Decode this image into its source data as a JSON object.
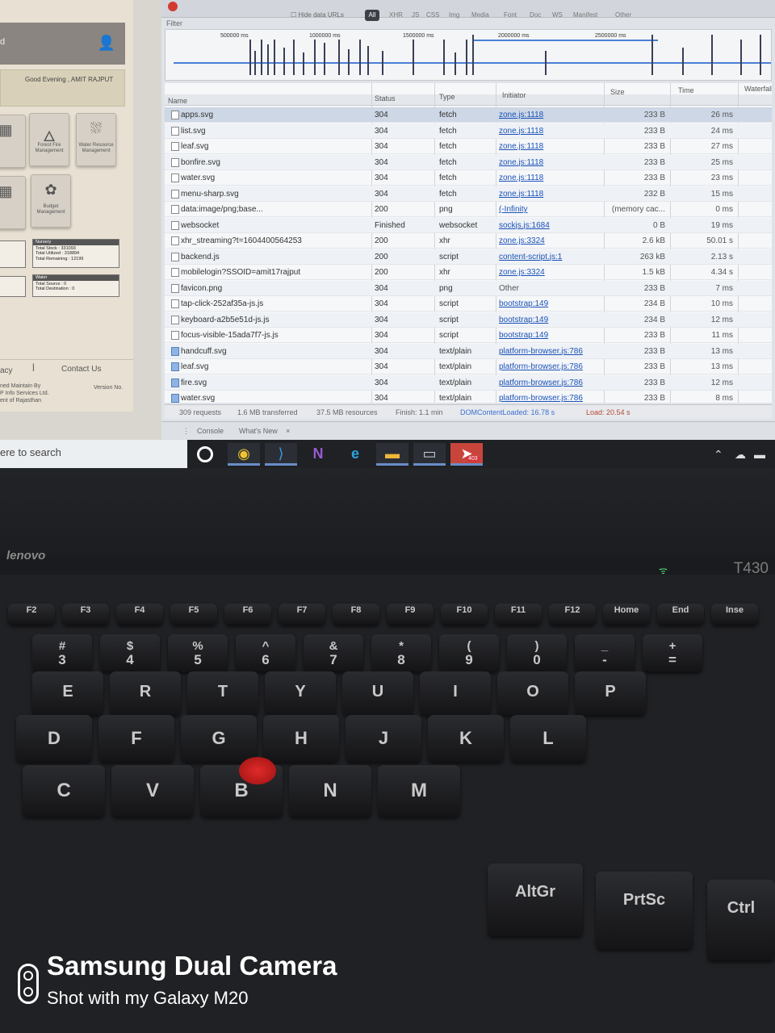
{
  "app": {
    "greeting": "Good Evening , AMIT RAJPUT",
    "tiles": [
      {
        "label": "Forest Fire Management",
        "icon": "fire-icon"
      },
      {
        "label": "Water Resource Management",
        "icon": "water-icon"
      },
      {
        "label": "Budget Management",
        "icon": "budget-icon"
      }
    ],
    "nursery": {
      "title": "Nursery",
      "lines": [
        "Total Stock : 331093",
        "Total Utilized : 318894",
        "Total Remaining : 12199"
      ]
    },
    "water": {
      "title": "Water",
      "lines": [
        "Total Source : 0",
        "Total Destination : 0"
      ]
    },
    "footer": {
      "policy": "acy",
      "contact": "Contact Us",
      "maintain": [
        "ned Maintain By",
        "P Info Services Ltd.",
        "ent of Rajasthan"
      ],
      "version": "Version No."
    }
  },
  "devtools": {
    "filter_placeholder": "Filter",
    "hide_data_urls": "Hide data URLs",
    "filter_tabs": [
      "All",
      "XHR",
      "JS",
      "CSS",
      "Img",
      "Media",
      "Font",
      "Doc",
      "WS",
      "Manifest",
      "Other"
    ],
    "timeline_ticks": [
      "500000 ms",
      "1000000 ms",
      "1500000 ms",
      "2000000 ms",
      "2500000 ms"
    ],
    "columns": {
      "name": "Name",
      "status": "Status",
      "type": "Type",
      "initiator": "Initiator",
      "size": "Size",
      "time": "Time",
      "waterfall": "Waterfall"
    },
    "rows": [
      {
        "name": "apps.svg",
        "status": "304",
        "type": "fetch",
        "initiator": "zone.js:1118",
        "size": "233 B",
        "time": "26 ms",
        "kind": "doc"
      },
      {
        "name": "list.svg",
        "status": "304",
        "type": "fetch",
        "initiator": "zone.js:1118",
        "size": "233 B",
        "time": "24 ms",
        "kind": "doc"
      },
      {
        "name": "leaf.svg",
        "status": "304",
        "type": "fetch",
        "initiator": "zone.js:1118",
        "size": "233 B",
        "time": "27 ms",
        "kind": "doc"
      },
      {
        "name": "bonfire.svg",
        "status": "304",
        "type": "fetch",
        "initiator": "zone.js:1118",
        "size": "233 B",
        "time": "25 ms",
        "kind": "doc"
      },
      {
        "name": "water.svg",
        "status": "304",
        "type": "fetch",
        "initiator": "zone.js:1118",
        "size": "233 B",
        "time": "23 ms",
        "kind": "doc"
      },
      {
        "name": "menu-sharp.svg",
        "status": "304",
        "type": "fetch",
        "initiator": "zone.js:1118",
        "size": "232 B",
        "time": "15 ms",
        "kind": "doc"
      },
      {
        "name": "data:image/png;base...",
        "status": "200",
        "type": "png",
        "initiator": "(-Infinity",
        "size": "(memory cac...",
        "time": "0 ms",
        "kind": "doc"
      },
      {
        "name": "websocket",
        "status": "Finished",
        "type": "websocket",
        "initiator": "sockjs.js:1684",
        "size": "0 B",
        "time": "19 ms",
        "kind": "doc"
      },
      {
        "name": "xhr_streaming?t=1604400564253",
        "status": "200",
        "type": "xhr",
        "initiator": "zone.js:3324",
        "size": "2.6 kB",
        "time": "50.01 s",
        "kind": "doc"
      },
      {
        "name": "backend.js",
        "status": "200",
        "type": "script",
        "initiator": "content-script.js:1",
        "size": "263 kB",
        "time": "2.13 s",
        "kind": "doc"
      },
      {
        "name": "mobilelogin?SSOID=amit17rajput",
        "status": "200",
        "type": "xhr",
        "initiator": "zone.js:3324",
        "size": "1.5 kB",
        "time": "4.34 s",
        "kind": "doc"
      },
      {
        "name": "favicon.png",
        "status": "304",
        "type": "png",
        "initiator": "Other",
        "size": "233 B",
        "time": "7 ms",
        "kind": "doc"
      },
      {
        "name": "tap-click-252af35a-js.js",
        "status": "304",
        "type": "script",
        "initiator": "bootstrap:149",
        "size": "234 B",
        "time": "10 ms",
        "kind": "doc"
      },
      {
        "name": "keyboard-a2b5e51d-js.js",
        "status": "304",
        "type": "script",
        "initiator": "bootstrap:149",
        "size": "234 B",
        "time": "12 ms",
        "kind": "doc"
      },
      {
        "name": "focus-visible-15ada7f7-js.js",
        "status": "304",
        "type": "script",
        "initiator": "bootstrap:149",
        "size": "233 B",
        "time": "11 ms",
        "kind": "doc"
      },
      {
        "name": "handcuff.svg",
        "status": "304",
        "type": "text/plain",
        "initiator": "platform-browser.js:786",
        "size": "233 B",
        "time": "13 ms",
        "kind": "img"
      },
      {
        "name": "leaf.svg",
        "status": "304",
        "type": "text/plain",
        "initiator": "platform-browser.js:786",
        "size": "233 B",
        "time": "13 ms",
        "kind": "img"
      },
      {
        "name": "fire.svg",
        "status": "304",
        "type": "text/plain",
        "initiator": "platform-browser.js:786",
        "size": "233 B",
        "time": "12 ms",
        "kind": "img"
      },
      {
        "name": "water.svg",
        "status": "304",
        "type": "text/plain",
        "initiator": "platform-browser.js:786",
        "size": "233 B",
        "time": "8 ms",
        "kind": "img"
      }
    ],
    "summary": {
      "requests": "309 requests",
      "transferred": "1.6 MB transferred",
      "resources": "37.5 MB resources",
      "finish": "Finish: 1.1 min",
      "dom": "DOMContentLoaded: 16.78 s",
      "load": "Load: 20.54 s"
    },
    "drawer": {
      "console": "Console",
      "whats_new": "What's New"
    }
  },
  "taskbar": {
    "search_placeholder": "ere to search",
    "apps": [
      {
        "name": "chrome",
        "icon": "chrome-icon",
        "glyph": "◉"
      },
      {
        "name": "vscode",
        "icon": "vscode-icon",
        "glyph": "⟩"
      },
      {
        "name": "onenote",
        "icon": "onenote-icon",
        "glyph": "N"
      },
      {
        "name": "edge",
        "icon": "edge-icon",
        "glyph": "e"
      },
      {
        "name": "explorer",
        "icon": "folder-icon",
        "glyph": "▬"
      },
      {
        "name": "terminal",
        "icon": "terminal-icon",
        "glyph": "▭"
      },
      {
        "name": "telegram",
        "icon": "telegram-icon",
        "glyph": "➤"
      }
    ],
    "badge": "403"
  },
  "laptop": {
    "brand": "lenovo",
    "model": "T430",
    "fkeys": [
      "F2",
      "F3",
      "F4",
      "F5",
      "F6",
      "F7",
      "F8",
      "F9",
      "F10",
      "F11",
      "F12",
      "Home",
      "End",
      "Inse"
    ],
    "number_row": [
      [
        "#",
        "3"
      ],
      [
        "$",
        "4"
      ],
      [
        "%",
        "5"
      ],
      [
        "^",
        "6"
      ],
      [
        "&",
        "7"
      ],
      [
        "*",
        "8"
      ],
      [
        "(",
        "9"
      ],
      [
        ")",
        "0"
      ],
      [
        "_",
        "-"
      ],
      [
        "+",
        "="
      ]
    ],
    "row_q": [
      "E",
      "R",
      "T",
      "Y",
      "U",
      "I",
      "O",
      "P"
    ],
    "row_a": [
      "D",
      "F",
      "G",
      "H",
      "J",
      "K",
      "L"
    ],
    "row_z": [
      "C",
      "V",
      "B",
      "N",
      "M"
    ],
    "bottom_keys": [
      "AltGr",
      "PrtSc",
      "Ctrl"
    ]
  },
  "watermark": {
    "title": "Samsung Dual Camera",
    "subtitle": "Shot with my Galaxy M20"
  }
}
